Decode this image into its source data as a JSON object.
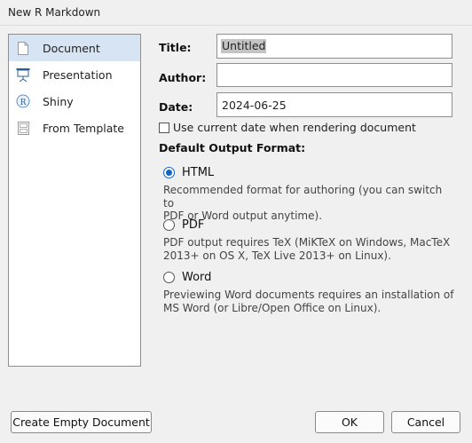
{
  "window": {
    "title": "New R Markdown"
  },
  "sidebar": {
    "items": [
      {
        "label": "Document",
        "icon": "document-icon",
        "selected": true
      },
      {
        "label": "Presentation",
        "icon": "presentation-icon",
        "selected": false
      },
      {
        "label": "Shiny",
        "icon": "shiny-icon",
        "selected": false
      },
      {
        "label": "From Template",
        "icon": "template-icon",
        "selected": false
      }
    ]
  },
  "form": {
    "title_label": "Title:",
    "title_value": "Untitled",
    "author_label": "Author:",
    "author_value": "",
    "date_label": "Date:",
    "date_value": "2024-06-25",
    "use_current_date_label": "Use current date when rendering document",
    "use_current_date_checked": false
  },
  "output": {
    "heading": "Default Output Format:",
    "options": [
      {
        "label": "HTML",
        "selected": true,
        "desc1": "Recommended format for authoring (you can switch to",
        "desc2": "PDF or Word output anytime)."
      },
      {
        "label": "PDF",
        "selected": false,
        "desc1": "PDF output requires TeX (MiKTeX on Windows, MacTeX",
        "desc2": "2013+ on OS X, TeX Live 2013+ on Linux)."
      },
      {
        "label": "Word",
        "selected": false,
        "desc1": "Previewing Word documents requires an installation of",
        "desc2": "MS Word (or Libre/Open Office on Linux)."
      }
    ]
  },
  "buttons": {
    "create_empty": "Create Empty Document",
    "ok": "OK",
    "cancel": "Cancel"
  },
  "colors": {
    "selection_bg": "#d6e4f3",
    "radio_accent": "#1565c0"
  }
}
